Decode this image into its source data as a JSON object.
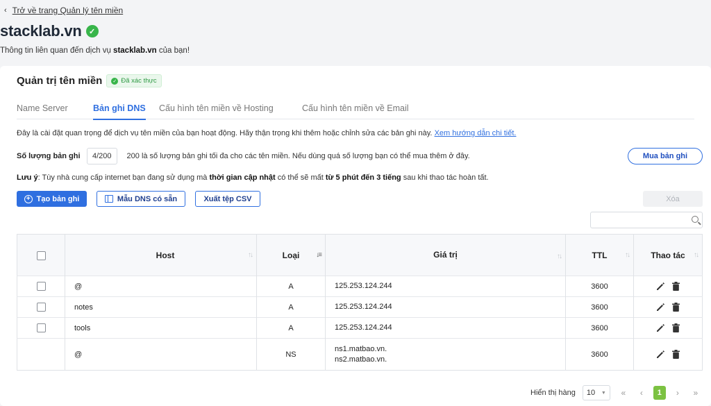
{
  "nav": {
    "back_label": "Trở về trang Quản lý tên miền"
  },
  "header": {
    "domain": "stacklab.vn",
    "subtitle_pre": "Thông tin liên quan đến dịch vụ ",
    "subtitle_domain": "stacklab.vn",
    "subtitle_post": " của bạn!"
  },
  "card": {
    "title": "Quản trị tên miền",
    "verified_label": "Đã xác thực",
    "tabs": [
      {
        "label": "Name Server",
        "active": false
      },
      {
        "label": "Bản ghi DNS",
        "active": true
      },
      {
        "label": "Cấu hình tên miền về Hosting",
        "active": false
      },
      {
        "label": "Cấu hình tên miền về Email",
        "active": false
      }
    ],
    "info_text": "Đây là cài đặt quan trọng để dịch vụ tên miền của bạn hoạt động. Hãy thận trọng khi thêm hoặc chỉnh sửa các bản ghi này.",
    "info_link": "Xem hướng dẫn chi tiết.",
    "count_label": "Số lượng bản ghi",
    "count_value": "4/200",
    "count_desc": "200 là số lượng bản ghi tối đa cho các tên miền. Nếu dùng quá số lượng bạn có thể mua thêm ở đây.",
    "buy_button": "Mua bản ghi",
    "note_prefix": "Lưu ý",
    "note_text1": ": Tùy nhà cung cấp internet bạn đang sử dụng mà ",
    "note_bold1": "thời gian cập nhật",
    "note_text2": " có thể sẽ mất ",
    "note_bold2": "từ 5 phút đến 3 tiếng",
    "note_text3": " sau khi thao tác hoàn tất.",
    "create_button": "Tạo bản ghi",
    "template_button": "Mẫu DNS có sẵn",
    "export_button": "Xuất tệp CSV",
    "delete_button": "Xóa",
    "search_placeholder": ""
  },
  "table": {
    "headers": {
      "host": "Host",
      "type": "Loại",
      "value": "Giá trị",
      "ttl": "TTL",
      "actions": "Thao tác"
    },
    "rows": [
      {
        "host": "@",
        "type": "A",
        "value1": "125.253.124.244",
        "value2": "",
        "ttl": "3600"
      },
      {
        "host": "notes",
        "type": "A",
        "value1": "125.253.124.244",
        "value2": "",
        "ttl": "3600"
      },
      {
        "host": "tools",
        "type": "A",
        "value1": "125.253.124.244",
        "value2": "",
        "ttl": "3600"
      },
      {
        "host": "@",
        "type": "NS",
        "value1": "ns1.matbao.vn.",
        "value2": "ns2.matbao.vn.",
        "ttl": "3600"
      }
    ]
  },
  "pagination": {
    "rows_label": "Hiển thị hàng",
    "page_size": "10",
    "current_page": "1",
    "first": "«",
    "prev": "‹",
    "next": "›",
    "last": "»"
  },
  "colors": {
    "accent": "#2f6fe0",
    "success": "#38b54a",
    "page_active": "#7cc242"
  }
}
